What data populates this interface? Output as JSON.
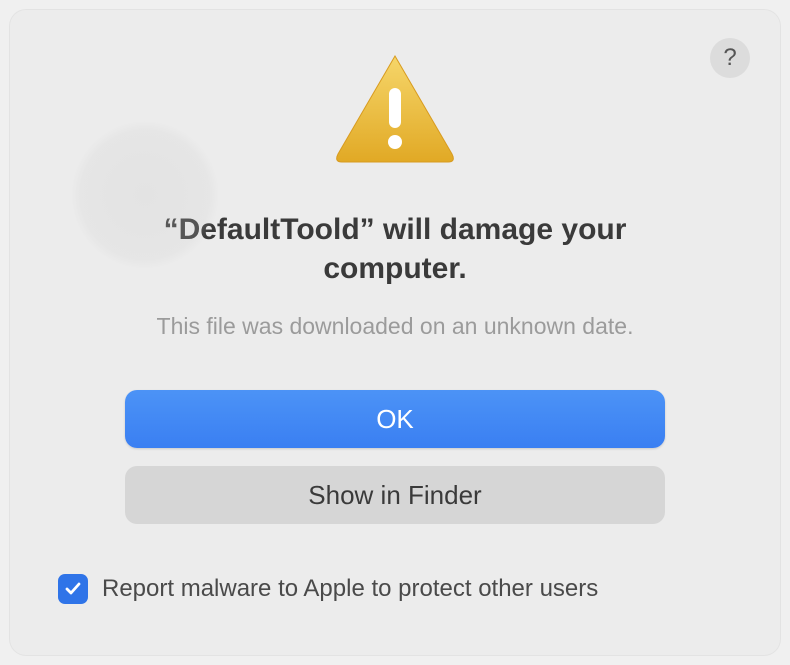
{
  "help": {
    "label": "?"
  },
  "alert": {
    "title": "“DefaultToold” will damage your computer.",
    "subtitle": "This file was downloaded on an unknown date."
  },
  "buttons": {
    "primary_label": "OK",
    "secondary_label": "Show in Finder"
  },
  "checkbox": {
    "label": "Report malware to Apple to protect other users",
    "checked": true
  },
  "colors": {
    "primary_blue": "#3a7ff2",
    "background": "#ececec"
  }
}
